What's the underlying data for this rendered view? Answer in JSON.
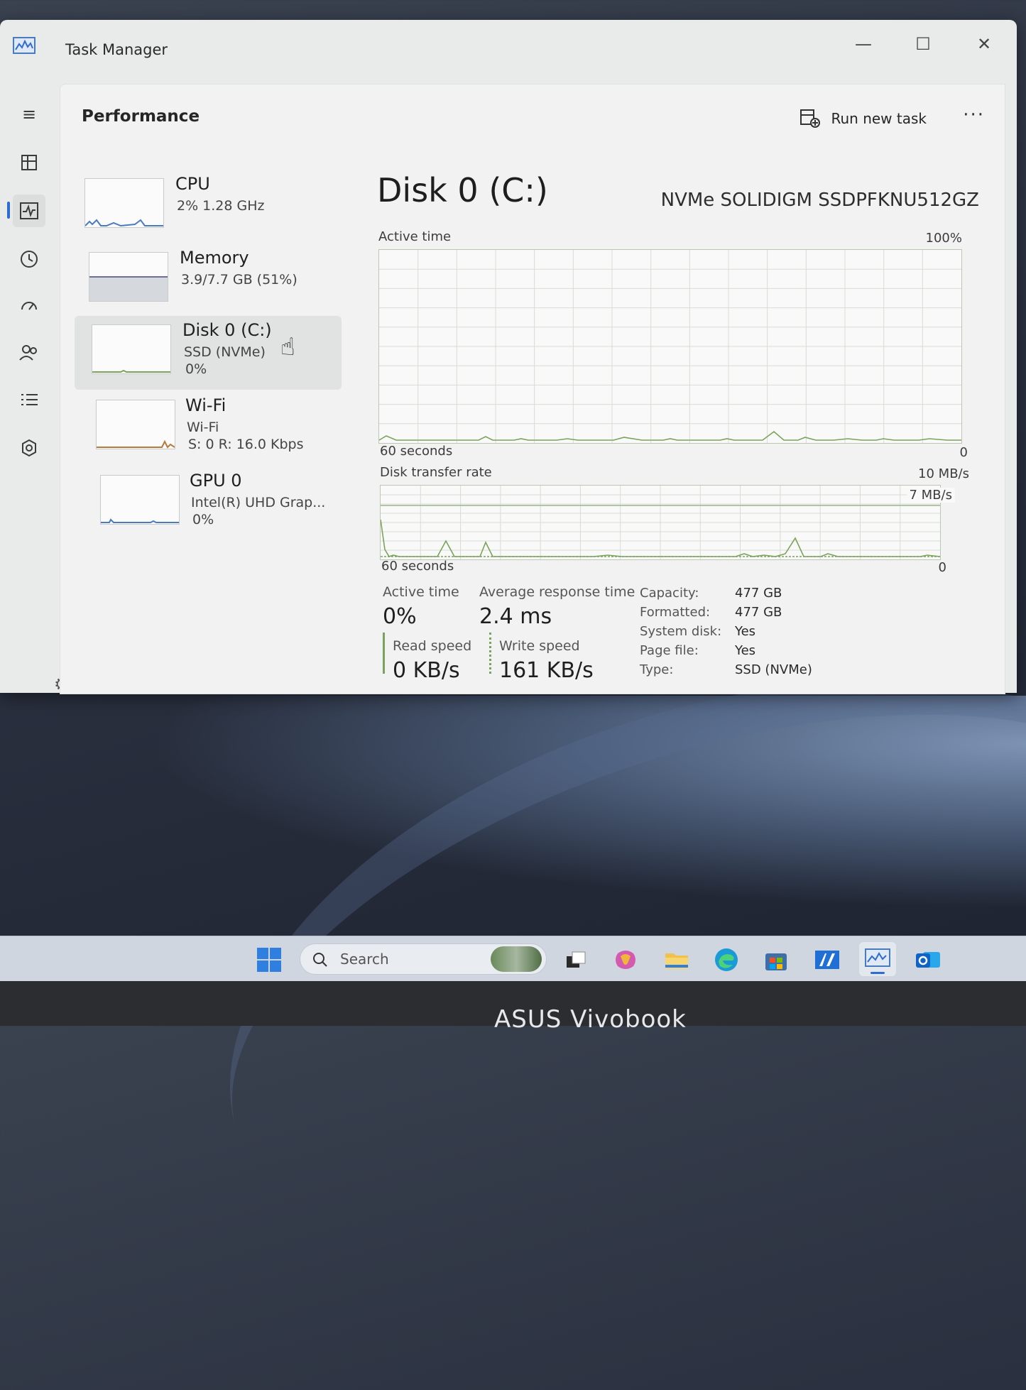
{
  "window": {
    "title": "Task Manager",
    "minimize_icon": "—",
    "maximize_icon": "☐",
    "close_icon": "✕"
  },
  "header": {
    "page_title": "Performance",
    "run_new_task": "Run new task",
    "more": "···"
  },
  "resources": [
    {
      "name": "CPU",
      "line1": "2%  1.28 GHz",
      "line2": ""
    },
    {
      "name": "Memory",
      "line1": "3.9/7.7 GB (51%)",
      "line2": ""
    },
    {
      "name": "Disk 0 (C:)",
      "line1": "SSD (NVMe)",
      "line2": "0%"
    },
    {
      "name": "Wi-Fi",
      "line1": "Wi-Fi",
      "line2": "S: 0  R: 16.0 Kbps"
    },
    {
      "name": "GPU 0",
      "line1": "Intel(R) UHD Grap...",
      "line2": "0%"
    }
  ],
  "detail": {
    "title": "Disk 0 (C:)",
    "model": "NVMe SOLIDIGM SSDPFKNU512GZ",
    "active_time_graph": {
      "label": "Active time",
      "max_label": "100%",
      "x_label": "60 seconds",
      "x_end": "0"
    },
    "transfer_graph": {
      "label": "Disk transfer rate",
      "max_label": "10 MB/s",
      "ref_label": "7 MB/s",
      "x_label": "60 seconds",
      "x_end": "0"
    },
    "stats": {
      "active_time_label": "Active time",
      "active_time_value": "0%",
      "avg_response_label": "Average response time",
      "avg_response_value": "2.4 ms",
      "read_speed_label": "Read speed",
      "read_speed_value": "0 KB/s",
      "write_speed_label": "Write speed",
      "write_speed_value": "161 KB/s"
    },
    "properties": [
      {
        "label": "Capacity:",
        "value": "477 GB"
      },
      {
        "label": "Formatted:",
        "value": "477 GB"
      },
      {
        "label": "System disk:",
        "value": "Yes"
      },
      {
        "label": "Page file:",
        "value": "Yes"
      },
      {
        "label": "Type:",
        "value": "SSD (NVMe)"
      }
    ]
  },
  "taskbar": {
    "search_placeholder": "Search"
  },
  "bezel": {
    "brand": "ASUS Vivobook"
  },
  "colors": {
    "accent": "#2f6bd4",
    "graph_line": "#7aa35a",
    "graph_grid": "#d7ddd3"
  }
}
